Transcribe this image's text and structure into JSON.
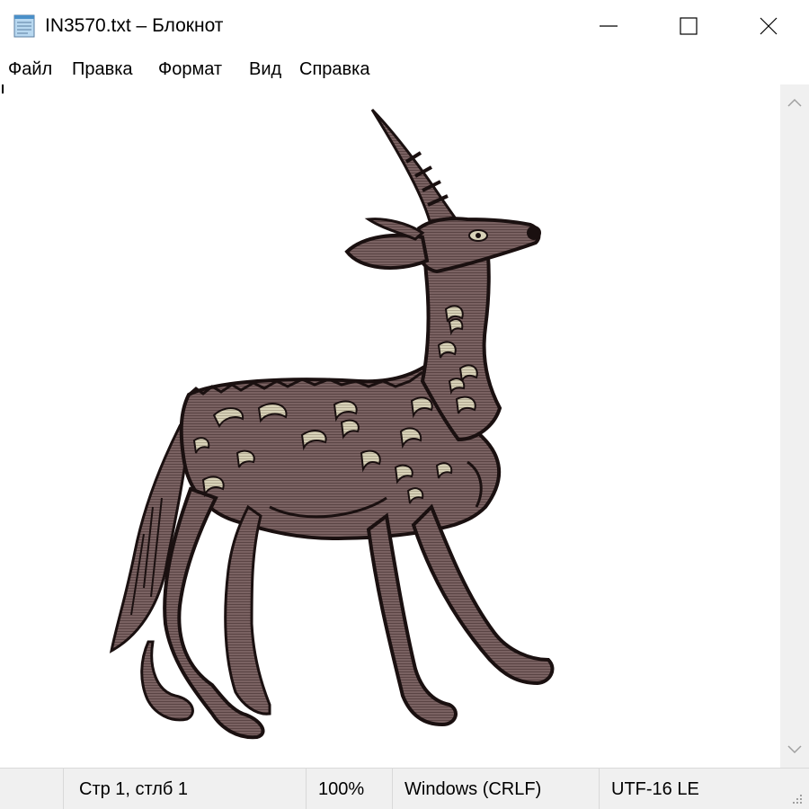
{
  "window": {
    "title": "IN3570.txt – Блокнот",
    "icons": {
      "app": "notepad-icon",
      "minimize": "minimize-icon",
      "maximize": "maximize-icon",
      "close": "close-icon"
    }
  },
  "menu": {
    "items": [
      "Файл",
      "Правка",
      "Формат",
      "Вид",
      "Справка"
    ]
  },
  "editor": {
    "content": "deer-ascii-art-image"
  },
  "scrollbar": {
    "up_icon": "chevron-up-icon",
    "down_icon": "chevron-down-icon"
  },
  "status": {
    "position": "Стр 1, стлб 1",
    "zoom": "100%",
    "line_endings": "Windows (CRLF)",
    "encoding": "UTF-16 LE",
    "grip_icon": "resize-grip-icon"
  },
  "colors": {
    "deer_body": "#7a6262",
    "deer_spots": "#d8d2b8",
    "outline": "#1a1010",
    "chrome_bg": "#f0f0f0"
  }
}
